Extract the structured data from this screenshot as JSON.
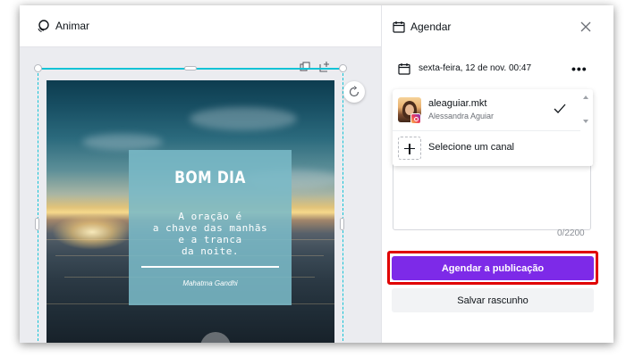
{
  "editor": {
    "animate_label": "Animar"
  },
  "post": {
    "title": "BOM DIA",
    "quote_lines": [
      "A oração é",
      "a chave das manhãs",
      "e a tranca",
      "da noite."
    ],
    "author": "Mahatma Gandhi"
  },
  "schedule_panel": {
    "title": "Agendar",
    "date_time": "sexta-feira, 12 de nov. 00:47",
    "more_label": "•••",
    "account": {
      "handle": "aleaguiar.mkt",
      "name": "Alessandra Aguiar",
      "network": "instagram"
    },
    "add_channel_label": "Selecione um canal",
    "char_counter": "0/2200",
    "publish_label": "Agendar a publicação",
    "draft_label": "Salvar rascunho"
  },
  "colors": {
    "accent": "#7d2ae8",
    "highlight": "#e00000",
    "selection": "#13c3d6"
  }
}
